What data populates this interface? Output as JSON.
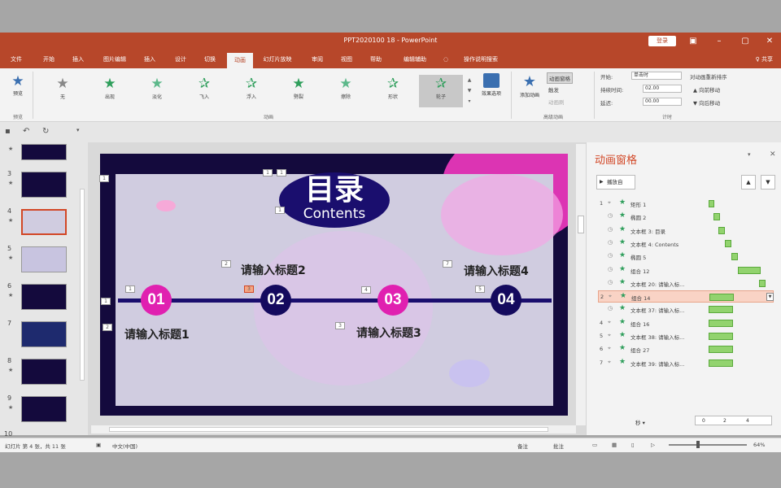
{
  "window": {
    "title": "PPT2020100 18 - PowerPoint",
    "login": "登录",
    "share": "♀ 共享"
  },
  "tabs": [
    "文件",
    "开始",
    "插入",
    "图片编辑",
    "插入",
    "设计",
    "切换",
    "动画",
    "幻灯片放映",
    "审阅",
    "视图",
    "帮助",
    "编辑辅助",
    "操作说明搜索"
  ],
  "ribbon": {
    "preview": "预览",
    "preview_group": "预览",
    "effects": [
      "无",
      "出现",
      "淡化",
      "飞入",
      "浮入",
      "劈裂",
      "擦除",
      "形状",
      "轮子"
    ],
    "effects_group": "动画",
    "effect_options": "效果选项",
    "add_animation": "添加动画",
    "anim_pane": "动画窗格",
    "trigger": "触发",
    "anim_painter": "动画刷",
    "advanced_group": "高级动画",
    "start_label": "开始:",
    "start_value": "单击时",
    "duration_label": "持续时间:",
    "duration_value": "02.00",
    "delay_label": "延迟:",
    "delay_value": "00.00",
    "timing_group": "计时",
    "reorder": "对动画重新排序",
    "move_earlier": "▲ 向前移动",
    "move_later": "▼ 向后移动"
  },
  "thumbnails": {
    "numbers": [
      "",
      "3",
      "4",
      "5",
      "6",
      "7",
      "8",
      "9",
      "10"
    ]
  },
  "slide": {
    "title": "目录",
    "subtitle": "Contents",
    "nodes": [
      "01",
      "02",
      "03",
      "04"
    ],
    "headings": [
      "请输入标题1",
      "请输入标题2",
      "请输入标题3",
      "请输入标题4"
    ],
    "tags": [
      "1",
      "1",
      "1",
      "1",
      "2",
      "1",
      "3",
      "1",
      "2",
      "4",
      "3",
      "5",
      "7"
    ]
  },
  "pane": {
    "title": "动画窗格",
    "play": "播放自",
    "items": [
      {
        "num": "1",
        "icon": "click",
        "name": "矩形 1",
        "sel": false
      },
      {
        "num": "",
        "icon": "clock",
        "name": "椭圆 2",
        "sel": false
      },
      {
        "num": "",
        "icon": "clock",
        "name": "文本框 3: 目录",
        "sel": false
      },
      {
        "num": "",
        "icon": "clock",
        "name": "文本框 4: Contents",
        "sel": false
      },
      {
        "num": "",
        "icon": "clock",
        "name": "椭圆 5",
        "sel": false
      },
      {
        "num": "",
        "icon": "clock",
        "name": "组合 12",
        "sel": false
      },
      {
        "num": "",
        "icon": "clock",
        "name": "文本框 20: 请输入标...",
        "sel": false
      },
      {
        "num": "2",
        "icon": "click",
        "name": "组合 14",
        "sel": true
      },
      {
        "num": "",
        "icon": "clock",
        "name": "文本框 37: 请输入标...",
        "sel": false
      },
      {
        "num": "4",
        "icon": "click",
        "name": "组合 16",
        "sel": false
      },
      {
        "num": "5",
        "icon": "click",
        "name": "文本框 38: 请输入标...",
        "sel": false
      },
      {
        "num": "6",
        "icon": "click",
        "name": "组合 27",
        "sel": false
      },
      {
        "num": "7",
        "icon": "click",
        "name": "文本框 39: 请输入标...",
        "sel": false
      }
    ],
    "seconds": "秒 ▾",
    "ticks": [
      "0",
      "2",
      "4"
    ]
  },
  "status": {
    "slide": "幻灯片 第 4 张，共 11 张",
    "lang": "中文(中国)",
    "notes": "备注",
    "comments": "批注",
    "zoom": "64%"
  },
  "colors": {
    "ribbon": "#b7472a",
    "accent": "#d24726",
    "node_pink": "#e020b0",
    "node_navy": "#140a5e"
  }
}
